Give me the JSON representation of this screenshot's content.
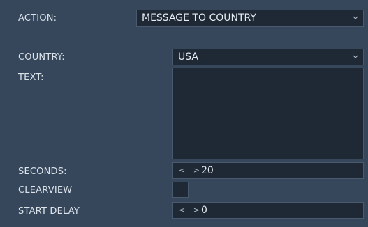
{
  "action": {
    "label": "ACTION:",
    "value": "MESSAGE TO COUNTRY"
  },
  "country": {
    "label": "COUNTRY:",
    "value": "USA"
  },
  "text": {
    "label": "TEXT:",
    "value": ""
  },
  "seconds": {
    "label": "SECONDS:",
    "value": "20"
  },
  "clearview": {
    "label": "CLEARVIEW",
    "checked": false
  },
  "start_delay": {
    "label": "START DELAY",
    "value": "0"
  },
  "stepper_glyph": "< >",
  "colors": {
    "background": "#36475c",
    "field": "#1f2936",
    "border": "#4a5a6e"
  }
}
